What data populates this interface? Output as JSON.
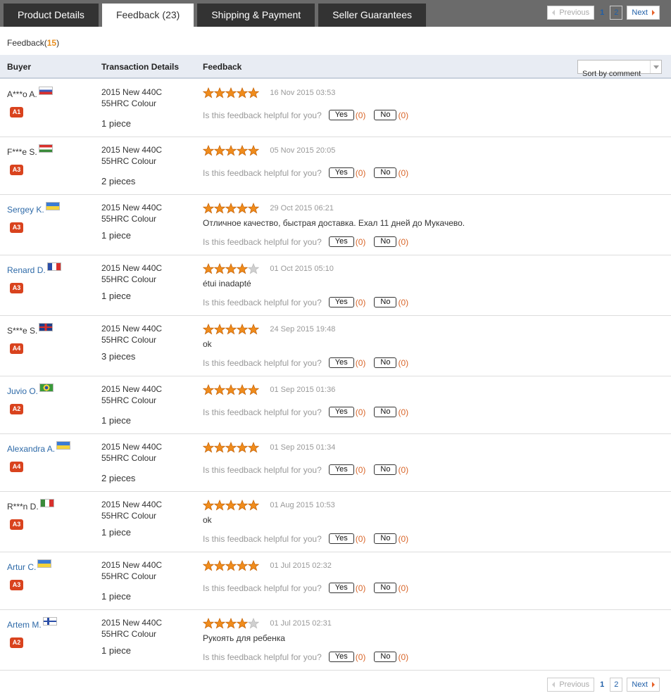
{
  "tabs": [
    {
      "label": "Product Details",
      "count": ""
    },
    {
      "label": "Feedback",
      "count": "(23)"
    },
    {
      "label": "Shipping & Payment",
      "count": ""
    },
    {
      "label": "Seller Guarantees",
      "count": ""
    }
  ],
  "header": {
    "title": "Feedback(",
    "count": "15",
    "close": ")"
  },
  "pagination": {
    "previous": "Previous",
    "pages": [
      "1",
      "2"
    ],
    "next": "Next"
  },
  "columns": {
    "buyer": "Buyer",
    "transaction": "Transaction Details",
    "feedback": "Feedback"
  },
  "sort": {
    "label": "Sort by comment"
  },
  "helpful": {
    "question": "Is this feedback helpful for you?",
    "yes": "Yes",
    "no": "No",
    "yes_count": "(0)",
    "no_count": "(0)"
  },
  "colors": {
    "star": "#f08c1c",
    "star_empty": "#d0d0d0",
    "badge": "#d9431e",
    "link": "#2e6aa8",
    "count": "#e88e1f"
  },
  "rows": [
    {
      "buyer": "A***o A.",
      "link": false,
      "flag": "ru",
      "level": "A1",
      "item": "2015 New 440C",
      "variant": "55HRC Colour",
      "qty": "1 piece",
      "stars": 5,
      "date": "16 Nov 2015 03:53",
      "comment": ""
    },
    {
      "buyer": "F***e S.",
      "link": false,
      "flag": "hu",
      "level": "A3",
      "item": "2015 New 440C",
      "variant": "55HRC Colour",
      "qty": "2 pieces",
      "stars": 5,
      "date": "05 Nov 2015 20:05",
      "comment": ""
    },
    {
      "buyer": "Sergey K.",
      "link": true,
      "flag": "ua",
      "level": "A3",
      "item": "2015 New 440C",
      "variant": "55HRC Colour",
      "qty": "1 piece",
      "stars": 5,
      "date": "29 Oct 2015 06:21",
      "comment": "Отличное качество, быстрая доставка. Ехал 11 дней до Мукачево."
    },
    {
      "buyer": "Renard D.",
      "link": true,
      "flag": "fr",
      "level": "A3",
      "item": "2015 New 440C",
      "variant": "55HRC Colour",
      "qty": "1 piece",
      "stars": 4,
      "date": "01 Oct 2015 05:10",
      "comment": "étui inadapté"
    },
    {
      "buyer": "S***e S.",
      "link": false,
      "flag": "gb",
      "level": "A4",
      "item": "2015 New 440C",
      "variant": "55HRC Colour",
      "qty": "3 pieces",
      "stars": 5,
      "date": "24 Sep 2015 19:48",
      "comment": "ok"
    },
    {
      "buyer": "Juvio O.",
      "link": true,
      "flag": "br",
      "level": "A2",
      "item": "2015 New 440C",
      "variant": "55HRC Colour",
      "qty": "1 piece",
      "stars": 5,
      "date": "01 Sep 2015 01:36",
      "comment": ""
    },
    {
      "buyer": "Alexandra A.",
      "link": true,
      "flag": "ua",
      "level": "A4",
      "item": "2015 New 440C",
      "variant": "55HRC Colour",
      "qty": "2 pieces",
      "stars": 5,
      "date": "01 Sep 2015 01:34",
      "comment": ""
    },
    {
      "buyer": "R***n D.",
      "link": false,
      "flag": "it",
      "level": "A3",
      "item": "2015 New 440C",
      "variant": "55HRC Colour",
      "qty": "1 piece",
      "stars": 5,
      "date": "01 Aug 2015 10:53",
      "comment": "ok"
    },
    {
      "buyer": "Artur C.",
      "link": true,
      "flag": "ua",
      "level": "A3",
      "item": "2015 New 440C",
      "variant": "55HRC Colour",
      "qty": "1 piece",
      "stars": 5,
      "date": "01 Jul 2015 02:32",
      "comment": ""
    },
    {
      "buyer": "Artem M.",
      "link": true,
      "flag": "fi",
      "level": "A2",
      "item": "2015 New 440C",
      "variant": "55HRC Colour",
      "qty": "1 piece",
      "stars": 4,
      "date": "01 Jul 2015 02:31",
      "comment": "Рукоять для ребенка"
    }
  ]
}
